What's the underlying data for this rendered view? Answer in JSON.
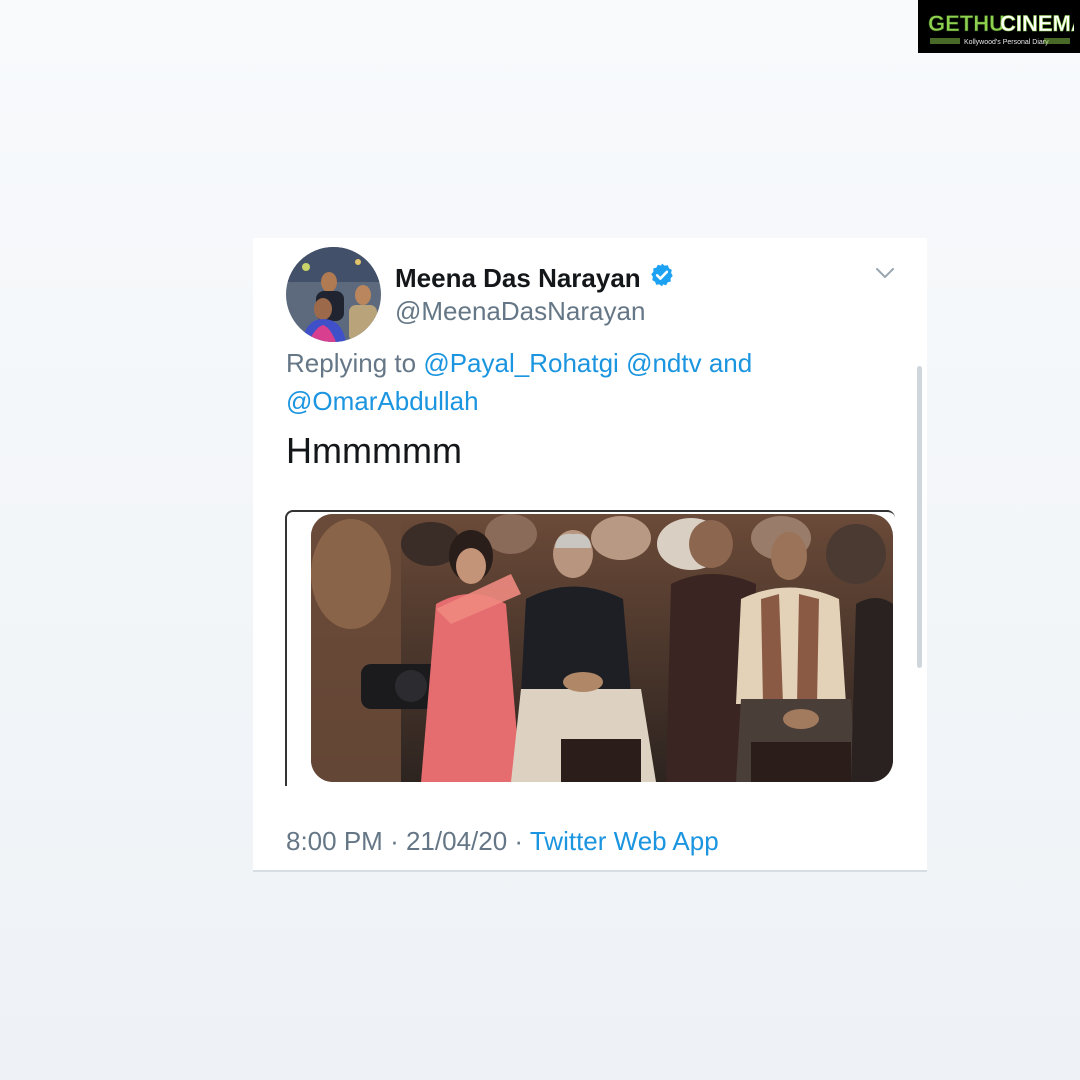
{
  "watermark": {
    "brand_part1": "GETHU",
    "brand_part2": "CINEMA",
    "tagline": "Kollywood's Personal Diary"
  },
  "tweet": {
    "display_name": "Meena Das Narayan",
    "handle": "@MeenaDasNarayan",
    "reply_prefix": "Replying to",
    "mentions": [
      "@Payal_Rohatgi",
      "@ndtv",
      "@OmarAbdullah"
    ],
    "reply_conjunction": "and",
    "text": "Hmmmmm",
    "time": "8:00 PM",
    "date": "21/04/20",
    "source": "Twitter Web App",
    "separator": "·"
  },
  "icons": {
    "verified": "verified-badge-icon",
    "chevron": "chevron-down-icon"
  },
  "colors": {
    "link": "#1b95e0",
    "secondary_text": "#657786",
    "primary_text": "#14171a",
    "verified": "#1da1f2",
    "watermark_green": "#8fd14f"
  }
}
